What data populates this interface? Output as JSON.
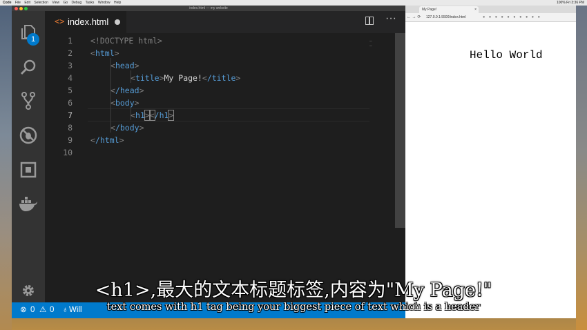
{
  "menubar": {
    "items": [
      "Code",
      "File",
      "Edit",
      "Selection",
      "View",
      "Go",
      "Debug",
      "Tasks",
      "Window",
      "Help"
    ],
    "right": "100% Fri 3:36 PM"
  },
  "vscode": {
    "window_title": "index.html — my website",
    "explorer_badge": "1",
    "icons": [
      "files-icon",
      "search-icon",
      "source-control-icon",
      "debug-icon",
      "extensions-icon",
      "docker-icon",
      "gear-icon"
    ],
    "tab": {
      "filename": "index.html"
    },
    "code_lines": [
      {
        "n": "1"
      },
      {
        "n": "2"
      },
      {
        "n": "3"
      },
      {
        "n": "4"
      },
      {
        "n": "5"
      },
      {
        "n": "6"
      },
      {
        "n": "7"
      },
      {
        "n": "8"
      },
      {
        "n": "9"
      },
      {
        "n": "10"
      }
    ],
    "code": {
      "doctype": "<!DOCTYPE html>",
      "html_open": "html",
      "head_open": "head",
      "title_open": "title",
      "title_text": "My Page!",
      "title_close": "/title",
      "head_close": "/head",
      "body_open": "body",
      "h1_open": "h1",
      "h1_close": "/h1",
      "body_close": "/body",
      "html_close": "/html"
    },
    "status": {
      "errors": "0",
      "warnings": "0",
      "user": "Will"
    }
  },
  "browser": {
    "tab_title": "My Page!",
    "url": "127.0.0.1:5500/index.html",
    "content_h1": "Hello World"
  },
  "subtitles": {
    "zh": "<h1>,最大的文本标题标签,内容为\"My Page!\"",
    "en": "text comes with h1 tag being your biggest piece of text which is a header"
  }
}
